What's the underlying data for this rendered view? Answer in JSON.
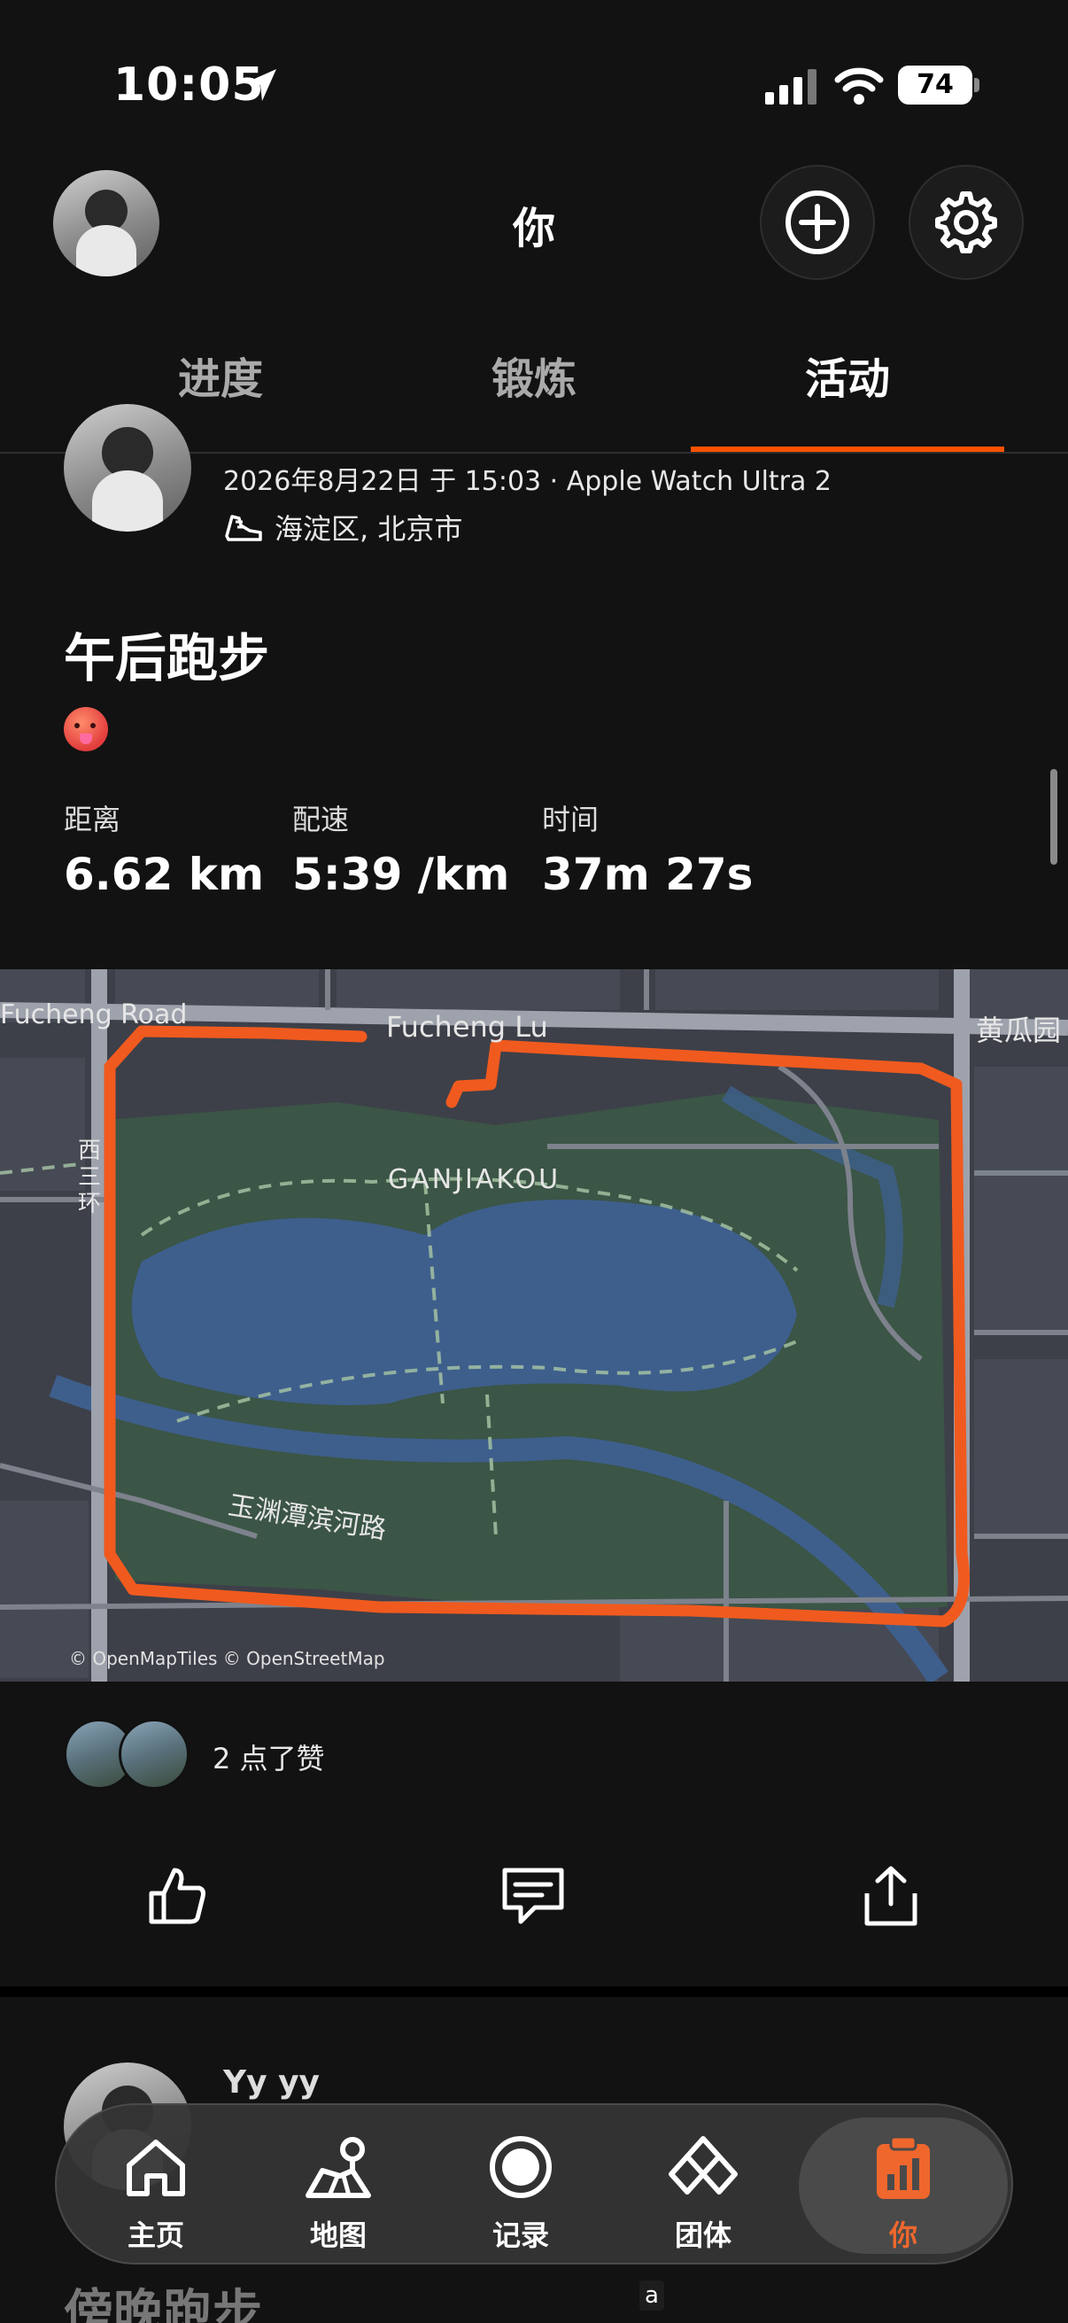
{
  "status_bar": {
    "time": "10:05",
    "battery": "74"
  },
  "header": {
    "title": "你"
  },
  "tabs": [
    {
      "label": "进度"
    },
    {
      "label": "锻炼"
    },
    {
      "label": "活动"
    }
  ],
  "activity": {
    "meta": "2026年8月22日 于 15:03 · Apple Watch Ultra 2",
    "location": "海淀区, 北京市",
    "title": "午后跑步",
    "stats": [
      {
        "label": "距离",
        "value": "6.62 km"
      },
      {
        "label": "配速",
        "value": "5:39 /km"
      },
      {
        "label": "时间",
        "value": "37m 27s"
      }
    ],
    "map": {
      "labels": {
        "fucheng_road": "Fucheng Road",
        "fucheng_lu": "Fucheng Lu",
        "huangguayuan": "黄瓜园",
        "ganjiakou": "GANJIAKOU",
        "west_ring": "西三环",
        "yuyuantan_road": "玉渊潭滨河路"
      },
      "attribution": "© OpenMapTiles © OpenStreetMap",
      "route_color": "#f05a1f"
    },
    "kudos": "2 点了赞"
  },
  "next_activity": {
    "name": "Yy yy",
    "title": "傍晚跑步"
  },
  "nav": [
    {
      "label": "主页",
      "icon": "home-icon"
    },
    {
      "label": "地图",
      "icon": "map-icon"
    },
    {
      "label": "记录",
      "icon": "record-icon"
    },
    {
      "label": "团体",
      "icon": "groups-icon"
    },
    {
      "label": "你",
      "icon": "you-icon"
    }
  ],
  "accent_color": "#fc5200",
  "bottom_hint": "a"
}
